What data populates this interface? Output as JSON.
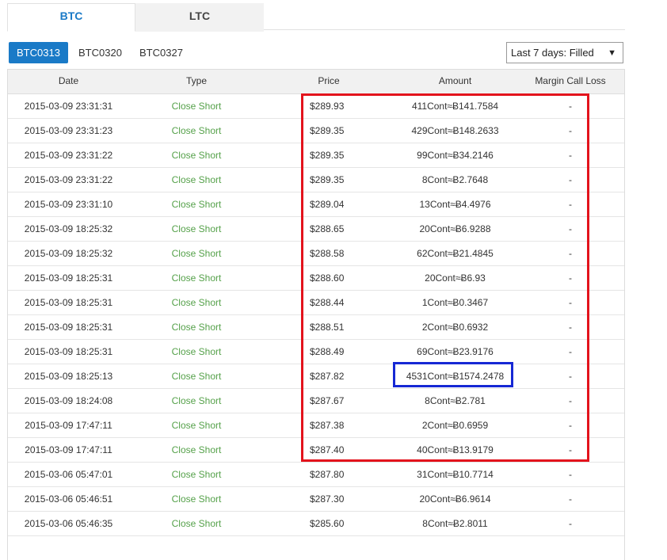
{
  "tabs": [
    {
      "label": "BTC",
      "active": true
    },
    {
      "label": "LTC",
      "active": false
    }
  ],
  "contracts": [
    {
      "label": "BTC0313",
      "active": true
    },
    {
      "label": "BTC0320",
      "active": false
    },
    {
      "label": "BTC0327",
      "active": false
    }
  ],
  "filter": {
    "selected": "Last 7 days: Filled",
    "arrow": "▼"
  },
  "columns": [
    "Date",
    "Type",
    "Price",
    "Amount",
    "Margin Call Loss"
  ],
  "rows": [
    {
      "date": "2015-03-09 23:31:31",
      "type": "Close Short",
      "price": "$289.93",
      "amount": "411Cont≈Ƀ141.7584",
      "loss": "-"
    },
    {
      "date": "2015-03-09 23:31:23",
      "type": "Close Short",
      "price": "$289.35",
      "amount": "429Cont≈Ƀ148.2633",
      "loss": "-"
    },
    {
      "date": "2015-03-09 23:31:22",
      "type": "Close Short",
      "price": "$289.35",
      "amount": "99Cont≈Ƀ34.2146",
      "loss": "-"
    },
    {
      "date": "2015-03-09 23:31:22",
      "type": "Close Short",
      "price": "$289.35",
      "amount": "8Cont≈Ƀ2.7648",
      "loss": "-"
    },
    {
      "date": "2015-03-09 23:31:10",
      "type": "Close Short",
      "price": "$289.04",
      "amount": "13Cont≈Ƀ4.4976",
      "loss": "-"
    },
    {
      "date": "2015-03-09 18:25:32",
      "type": "Close Short",
      "price": "$288.65",
      "amount": "20Cont≈Ƀ6.9288",
      "loss": "-"
    },
    {
      "date": "2015-03-09 18:25:32",
      "type": "Close Short",
      "price": "$288.58",
      "amount": "62Cont≈Ƀ21.4845",
      "loss": "-"
    },
    {
      "date": "2015-03-09 18:25:31",
      "type": "Close Short",
      "price": "$288.60",
      "amount": "20Cont≈Ƀ6.93",
      "loss": "-"
    },
    {
      "date": "2015-03-09 18:25:31",
      "type": "Close Short",
      "price": "$288.44",
      "amount": "1Cont≈Ƀ0.3467",
      "loss": "-"
    },
    {
      "date": "2015-03-09 18:25:31",
      "type": "Close Short",
      "price": "$288.51",
      "amount": "2Cont≈Ƀ0.6932",
      "loss": "-"
    },
    {
      "date": "2015-03-09 18:25:31",
      "type": "Close Short",
      "price": "$288.49",
      "amount": "69Cont≈Ƀ23.9176",
      "loss": "-"
    },
    {
      "date": "2015-03-09 18:25:13",
      "type": "Close Short",
      "price": "$287.82",
      "amount": "4531Cont≈Ƀ1574.2478",
      "loss": "-"
    },
    {
      "date": "2015-03-09 18:24:08",
      "type": "Close Short",
      "price": "$287.67",
      "amount": "8Cont≈Ƀ2.781",
      "loss": "-"
    },
    {
      "date": "2015-03-09 17:47:11",
      "type": "Close Short",
      "price": "$287.38",
      "amount": "2Cont≈Ƀ0.6959",
      "loss": "-"
    },
    {
      "date": "2015-03-09 17:47:11",
      "type": "Close Short",
      "price": "$287.40",
      "amount": "40Cont≈Ƀ13.9179",
      "loss": "-"
    },
    {
      "date": "2015-03-06 05:47:01",
      "type": "Close Short",
      "price": "$287.80",
      "amount": "31Cont≈Ƀ10.7714",
      "loss": "-"
    },
    {
      "date": "2015-03-06 05:46:51",
      "type": "Close Short",
      "price": "$287.30",
      "amount": "20Cont≈Ƀ6.9614",
      "loss": "-"
    },
    {
      "date": "2015-03-06 05:46:35",
      "type": "Close Short",
      "price": "$285.60",
      "amount": "8Cont≈Ƀ2.8011",
      "loss": "-"
    },
    {
      "date": "",
      "type": "",
      "price": "",
      "amount": "",
      "loss": ""
    }
  ],
  "colors": {
    "accent": "#1a7ac7",
    "close_short": "#55a14a",
    "highlight_red": "#e3131c",
    "highlight_blue": "#1628d4"
  }
}
